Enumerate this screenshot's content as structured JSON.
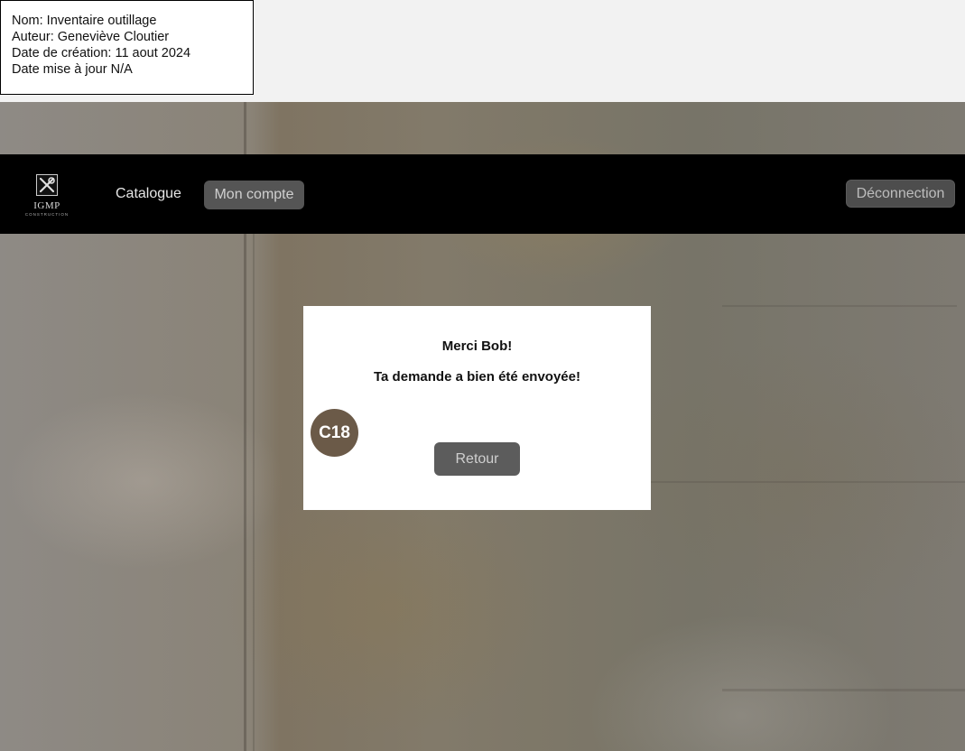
{
  "meta": {
    "name_line": "Nom: Inventaire outillage",
    "author_line": "Auteur: Geneviève Cloutier",
    "created_line": "Date de création: 11 aout 2024",
    "updated_line": "Date mise à jour N/A"
  },
  "header": {
    "logo_text": "IGMP",
    "logo_sub": "CONSTRUCTION",
    "nav": {
      "catalogue": "Catalogue",
      "account": "Mon compte"
    },
    "logout": "Déconnection"
  },
  "dialog": {
    "title": "Merci Bob!",
    "message": "Ta demande a bien été envoyée!",
    "back_button": "Retour"
  },
  "badge": "C18",
  "colors": {
    "nav_bg": "#000000",
    "active_tab_bg": "#555555",
    "badge_bg": "#6b5a48",
    "button_bg": "#5c5c5c"
  }
}
